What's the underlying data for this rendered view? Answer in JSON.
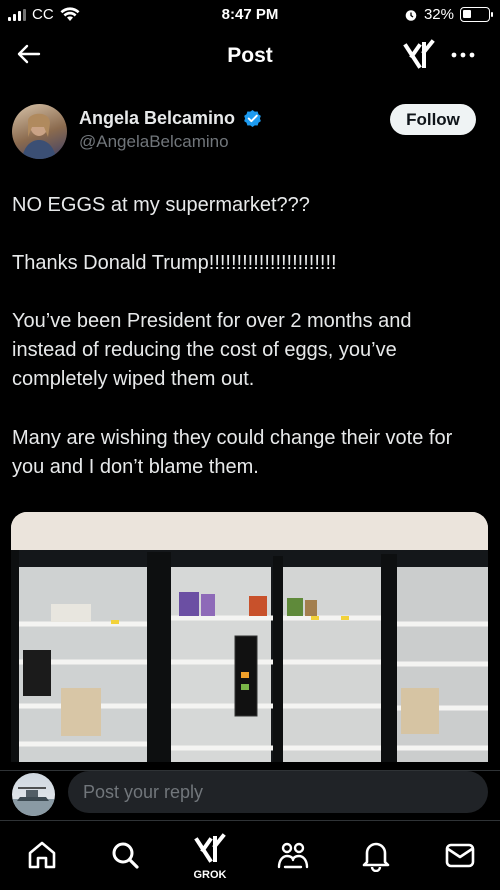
{
  "status_bar": {
    "time": "8:47 PM",
    "carrier": "CC",
    "battery": "32%"
  },
  "header": {
    "title": "Post",
    "back_icon": "back-arrow-icon",
    "grok_icon": "grok-icon",
    "more_icon": "more-icon"
  },
  "post": {
    "author_name": "Angela Belcamino",
    "handle": "@AngelaBelcamino",
    "follow_label": "Follow",
    "paragraphs": [
      [
        "NO EGGS at my supermarket???"
      ],
      [
        "Thanks Donald Trump!!!!!!!!!!!!!!!!!!!!!!!"
      ],
      [
        "You’ve been President for over 2 months and",
        "instead of reducing the cost of eggs, you’ve",
        "completely wiped them out."
      ],
      [
        "Many are wishing they could change their vote for",
        "you and I don’t blame them."
      ]
    ]
  },
  "reply": {
    "placeholder": "Post your reply"
  },
  "tabbar": {
    "grok_label": "GROK",
    "items": [
      "home-icon",
      "search-icon",
      "grok-icon",
      "communities-icon",
      "notifications-icon",
      "messages-icon"
    ]
  },
  "colors": {
    "background": "#000000",
    "text": "#e7e9ea",
    "muted": "#71767b",
    "verified": "#1d9bf0"
  }
}
